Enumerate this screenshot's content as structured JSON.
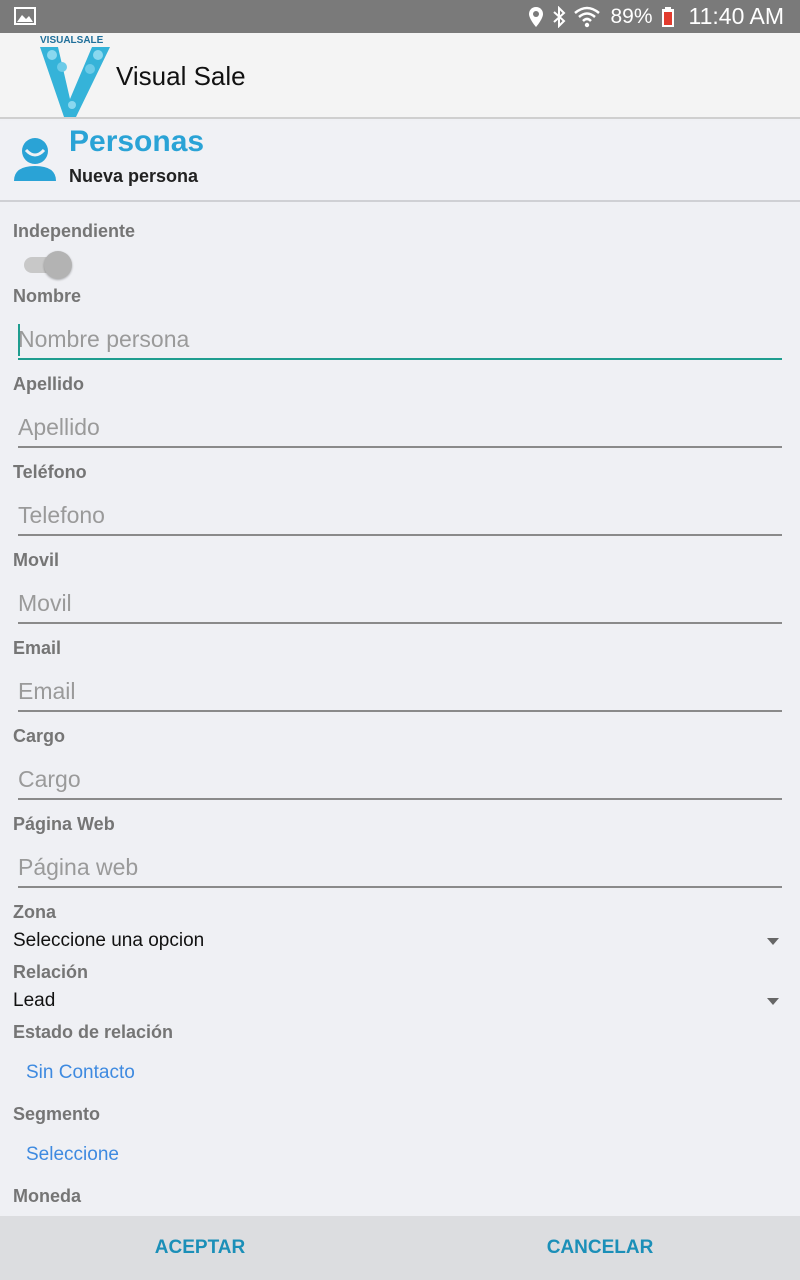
{
  "status_bar": {
    "battery_percent": "89%",
    "time": "11:40 AM",
    "icons": [
      "gallery-icon",
      "location-icon",
      "bluetooth-icon",
      "wifi-icon",
      "battery-icon"
    ]
  },
  "app_bar": {
    "logo_text": "VISUALSALE",
    "title": "Visual Sale"
  },
  "section": {
    "title": "Personas",
    "subtitle": "Nueva persona",
    "icon": "person-icon",
    "accent_color": "#2aa3d6"
  },
  "form": {
    "independiente": {
      "label": "Independiente",
      "checked": false
    },
    "nombre": {
      "label": "Nombre",
      "placeholder": "Nombre persona",
      "value": ""
    },
    "apellido": {
      "label": "Apellido",
      "placeholder": "Apellido",
      "value": ""
    },
    "telefono": {
      "label": "Teléfono",
      "placeholder": "Telefono",
      "value": ""
    },
    "movil": {
      "label": "Movil",
      "placeholder": "Movil",
      "value": ""
    },
    "email": {
      "label": "Email",
      "placeholder": "Email",
      "value": ""
    },
    "cargo": {
      "label": "Cargo",
      "placeholder": "Cargo",
      "value": ""
    },
    "pagina_web": {
      "label": "Página Web",
      "placeholder": "Página web",
      "value": ""
    },
    "zona": {
      "label": "Zona",
      "value": "Seleccione una opcion"
    },
    "relacion": {
      "label": "Relación",
      "value": "Lead"
    },
    "estado_relacion": {
      "label": "Estado de relación",
      "value": "Sin Contacto"
    },
    "segmento": {
      "label": "Segmento",
      "value": "Seleccione"
    },
    "moneda": {
      "label": "Moneda"
    }
  },
  "actions": {
    "accept": "ACEPTAR",
    "cancel": "CANCELAR",
    "color": "#1b8fb8"
  }
}
